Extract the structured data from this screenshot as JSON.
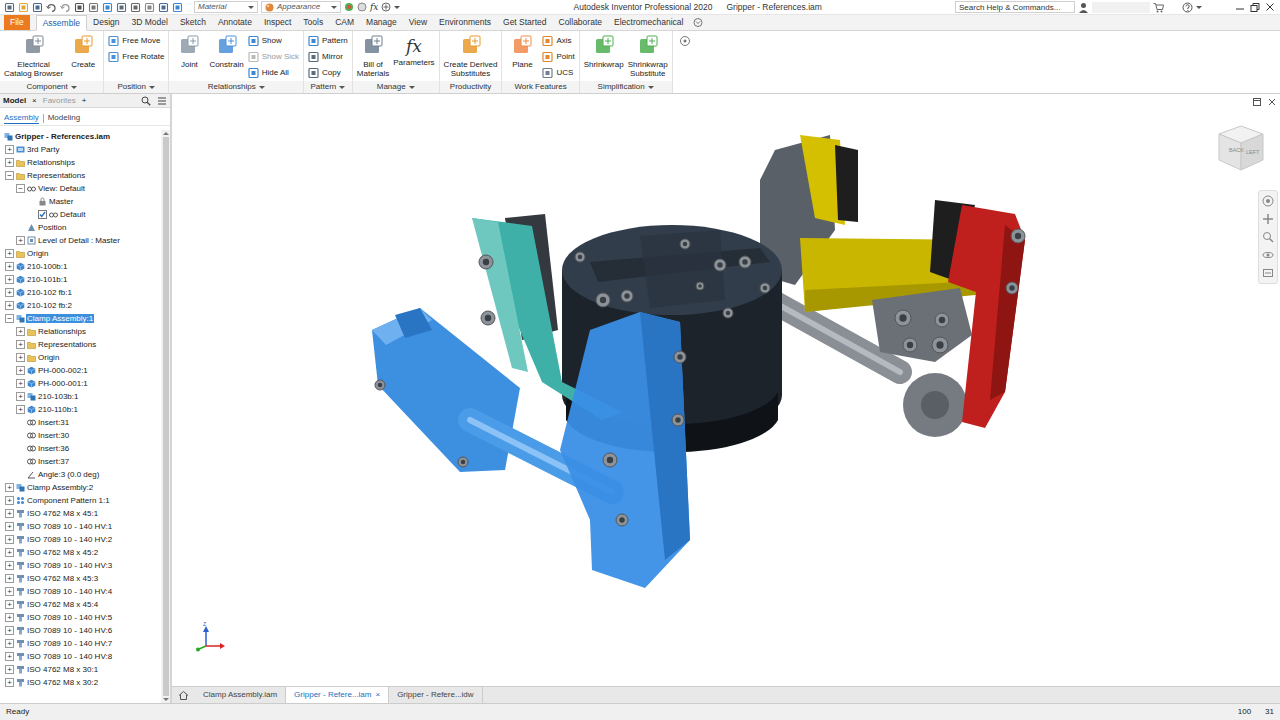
{
  "window": {
    "title": "Autodesk Inventor Professional 2020",
    "document": "Gripper - References.iam"
  },
  "quick_access": {
    "material": "Material",
    "appearance": "Appearance",
    "fx": "fx"
  },
  "search": {
    "placeholder": "Search Help & Commands..."
  },
  "ribbon_tabs": [
    {
      "label": "File",
      "kind": "menu",
      "selected": false
    },
    {
      "label": "Assemble",
      "kind": "tab",
      "selected": true
    },
    {
      "label": "Design",
      "kind": "tab",
      "selected": false
    },
    {
      "label": "3D Model",
      "kind": "tab",
      "selected": false
    },
    {
      "label": "Sketch",
      "kind": "tab",
      "selected": false
    },
    {
      "label": "Annotate",
      "kind": "tab",
      "selected": false
    },
    {
      "label": "Inspect",
      "kind": "tab",
      "selected": false
    },
    {
      "label": "Tools",
      "kind": "tab",
      "selected": false
    },
    {
      "label": "CAM",
      "kind": "tab",
      "selected": false
    },
    {
      "label": "Manage",
      "kind": "tab",
      "selected": false
    },
    {
      "label": "View",
      "kind": "tab",
      "selected": false
    },
    {
      "label": "Environments",
      "kind": "tab",
      "selected": false
    },
    {
      "label": "Get Started",
      "kind": "tab",
      "selected": false
    },
    {
      "label": "Collaborate",
      "kind": "tab",
      "selected": false
    },
    {
      "label": "Electromechanical",
      "kind": "tab",
      "selected": false
    }
  ],
  "ribbon_groups": [
    {
      "label": "Component",
      "menu": true,
      "large": [
        {
          "label": "Electrical\nCatalog Browser"
        },
        {
          "label": "Create"
        }
      ],
      "small": []
    },
    {
      "label": "Position",
      "menu": true,
      "large": [],
      "small": [
        {
          "label": "Free Move",
          "disabled": false
        },
        {
          "label": "Free Rotate",
          "disabled": false
        }
      ]
    },
    {
      "label": "Relationships",
      "menu": true,
      "large": [
        {
          "label": "Joint"
        },
        {
          "label": "Constrain"
        }
      ],
      "small": [
        {
          "label": "Show",
          "disabled": false
        },
        {
          "label": "Show Sick",
          "disabled": true
        },
        {
          "label": "Hide All",
          "disabled": false
        }
      ]
    },
    {
      "label": "Pattern",
      "menu": true,
      "large": [],
      "small": [
        {
          "label": "Pattern",
          "disabled": false
        },
        {
          "label": "Mirror",
          "disabled": false
        },
        {
          "label": "Copy",
          "disabled": false
        }
      ]
    },
    {
      "label": "Manage",
      "menu": true,
      "large": [
        {
          "label": "Bill of\nMaterials"
        },
        {
          "label": "Parameters",
          "glyph": "fx"
        }
      ],
      "small": []
    },
    {
      "label": "Productivity",
      "menu": false,
      "large": [
        {
          "label": "Create Derived\nSubstitutes"
        }
      ],
      "small": []
    },
    {
      "label": "Work Features",
      "menu": false,
      "large": [
        {
          "label": "Plane"
        }
      ],
      "small": [
        {
          "label": "Axis",
          "disabled": false
        },
        {
          "label": "Point",
          "disabled": false
        },
        {
          "label": "UCS",
          "disabled": false
        }
      ]
    },
    {
      "label": "Simplification",
      "menu": true,
      "large": [
        {
          "label": "Shrinkwrap"
        },
        {
          "label": "Shrinkwrap\nSubstitute"
        }
      ],
      "small": []
    }
  ],
  "browser": {
    "tabs": [
      {
        "label": "Model",
        "selected": true,
        "close": "×"
      },
      {
        "label": "Favorites",
        "selected": false
      }
    ],
    "add": "+",
    "modes": [
      {
        "label": "Assembly",
        "selected": true
      },
      {
        "label": "Modeling",
        "selected": false
      }
    ],
    "tree": [
      {
        "label": "Gripper - References.iam",
        "level": 0,
        "toggle": "",
        "kind": "root",
        "selected": false
      },
      {
        "label": "3rd Party",
        "level": 1,
        "toggle": "+",
        "kind": "thirdparty",
        "selected": false
      },
      {
        "label": "Relationships",
        "level": 1,
        "toggle": "+",
        "kind": "folder",
        "selected": false
      },
      {
        "label": "Representations",
        "level": 1,
        "toggle": "−",
        "kind": "folder",
        "selected": false
      },
      {
        "label": "View: Default",
        "level": 2,
        "toggle": "−",
        "kind": "view",
        "selected": false
      },
      {
        "label": "Master",
        "level": 3,
        "toggle": "",
        "kind": "lock",
        "selected": false
      },
      {
        "label": "Default",
        "level": 3,
        "toggle": "",
        "kind": "checkbox",
        "checked": true,
        "selected": false
      },
      {
        "label": "Position",
        "level": 2,
        "toggle": "",
        "kind": "position",
        "selected": false
      },
      {
        "label": "Level of Detail : Master",
        "level": 2,
        "toggle": "+",
        "kind": "lod",
        "selected": false
      },
      {
        "label": "Origin",
        "level": 1,
        "toggle": "+",
        "kind": "folder",
        "selected": false
      },
      {
        "label": "210-100b:1",
        "level": 1,
        "toggle": "+",
        "kind": "part",
        "selected": false
      },
      {
        "label": "210-101b:1",
        "level": 1,
        "toggle": "+",
        "kind": "part",
        "selected": false
      },
      {
        "label": "210-102 fb:1",
        "level": 1,
        "toggle": "+",
        "kind": "part",
        "selected": false
      },
      {
        "label": "210-102 fb:2",
        "level": 1,
        "toggle": "+",
        "kind": "part",
        "selected": false
      },
      {
        "label": "Clamp Assembly:1",
        "level": 1,
        "toggle": "−",
        "kind": "assembly",
        "selected": true
      },
      {
        "label": "Relationships",
        "level": 2,
        "toggle": "+",
        "kind": "folder",
        "selected": false
      },
      {
        "label": "Representations",
        "level": 2,
        "toggle": "+",
        "kind": "folder",
        "selected": false
      },
      {
        "label": "Origin",
        "level": 2,
        "toggle": "+",
        "kind": "folder",
        "selected": false
      },
      {
        "label": "PH-000-002:1",
        "level": 2,
        "toggle": "+",
        "kind": "part",
        "selected": false
      },
      {
        "label": "PH-000-001:1",
        "level": 2,
        "toggle": "+",
        "kind": "part",
        "selected": false
      },
      {
        "label": "210-103b:1",
        "level": 2,
        "toggle": "+",
        "kind": "assembly",
        "selected": false
      },
      {
        "label": "210-110b:1",
        "level": 2,
        "toggle": "+",
        "kind": "part",
        "selected": false
      },
      {
        "label": "Insert:31",
        "level": 2,
        "toggle": "",
        "kind": "insert",
        "selected": false
      },
      {
        "label": "Insert:30",
        "level": 2,
        "toggle": "",
        "kind": "insert",
        "selected": false
      },
      {
        "label": "Insert:36",
        "level": 2,
        "toggle": "",
        "kind": "insert",
        "selected": false
      },
      {
        "label": "Insert:37",
        "level": 2,
        "toggle": "",
        "kind": "insert",
        "selected": false
      },
      {
        "label": "Angle:3 (0.0 deg)",
        "level": 2,
        "toggle": "",
        "kind": "angle",
        "selected": false
      },
      {
        "label": "Clamp Assembly:2",
        "level": 1,
        "toggle": "+",
        "kind": "assembly",
        "selected": false
      },
      {
        "label": "Component Pattern 1:1",
        "level": 1,
        "toggle": "+",
        "kind": "pattern",
        "selected": false
      },
      {
        "label": "ISO 4762 M8 x 45:1",
        "level": 1,
        "toggle": "+",
        "kind": "bolt",
        "selected": false
      },
      {
        "label": "ISO 7089 10 - 140 HV:1",
        "level": 1,
        "toggle": "+",
        "kind": "bolt",
        "selected": false
      },
      {
        "label": "ISO 7089 10 - 140 HV:2",
        "level": 1,
        "toggle": "+",
        "kind": "bolt",
        "selected": false
      },
      {
        "label": "ISO 4762 M8 x 45:2",
        "level": 1,
        "toggle": "+",
        "kind": "bolt",
        "selected": false
      },
      {
        "label": "ISO 7089 10 - 140 HV:3",
        "level": 1,
        "toggle": "+",
        "kind": "bolt",
        "selected": false
      },
      {
        "label": "ISO 4762 M8 x 45:3",
        "level": 1,
        "toggle": "+",
        "kind": "bolt",
        "selected": false
      },
      {
        "label": "ISO 7089 10 - 140 HV:4",
        "level": 1,
        "toggle": "+",
        "kind": "bolt",
        "selected": false
      },
      {
        "label": "ISO 4762 M8 x 45:4",
        "level": 1,
        "toggle": "+",
        "kind": "bolt",
        "selected": false
      },
      {
        "label": "ISO 7089 10 - 140 HV:5",
        "level": 1,
        "toggle": "+",
        "kind": "bolt",
        "selected": false
      },
      {
        "label": "ISO 7089 10 - 140 HV:6",
        "level": 1,
        "toggle": "+",
        "kind": "bolt",
        "selected": false
      },
      {
        "label": "ISO 7089 10 - 140 HV:7",
        "level": 1,
        "toggle": "+",
        "kind": "bolt",
        "selected": false
      },
      {
        "label": "ISO 7089 10 - 140 HV:8",
        "level": 1,
        "toggle": "+",
        "kind": "bolt",
        "selected": false
      },
      {
        "label": "ISO 4762 M8 x 30:1",
        "level": 1,
        "toggle": "+",
        "kind": "bolt",
        "selected": false
      },
      {
        "label": "ISO 4762 M8 x 30:2",
        "level": 1,
        "toggle": "+",
        "kind": "bolt",
        "selected": false
      }
    ]
  },
  "viewcube": {
    "faces": [
      "BACK",
      "LEFT"
    ]
  },
  "axis": {
    "label": "Z"
  },
  "document_tabs": [
    {
      "label": "Clamp Assembly.iam",
      "selected": false
    },
    {
      "label": "Gripper - Refere...iam",
      "selected": true,
      "close": "×"
    },
    {
      "label": "Gripper - Refere...idw",
      "selected": false
    }
  ],
  "status_bar": {
    "text": "Ready",
    "zoom": "100",
    "count": "31"
  }
}
